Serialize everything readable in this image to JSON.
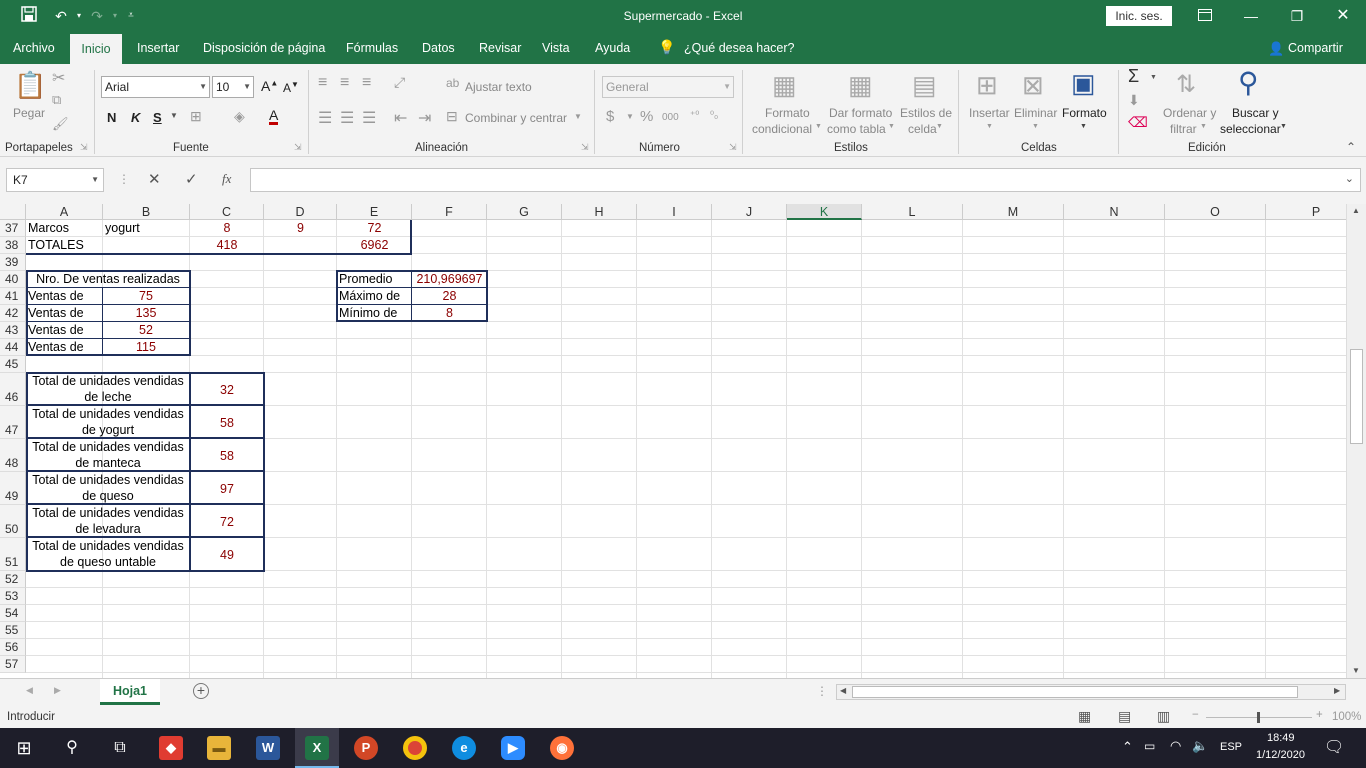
{
  "window": {
    "title": "Supermercado  -  Excel",
    "signin": "Inic. ses."
  },
  "tabs": [
    "Archivo",
    "Inicio",
    "Insertar",
    "Disposición de página",
    "Fórmulas",
    "Datos",
    "Revisar",
    "Vista",
    "Ayuda"
  ],
  "active_tab": "Inicio",
  "search_tell": "¿Qué desea hacer?",
  "share": "Compartir",
  "ribbon": {
    "paste": "Pegar",
    "font_name": "Arial",
    "font_size": "10",
    "bold": "N",
    "italic": "K",
    "underline": "S",
    "wrap_text": "Ajustar texto",
    "merge_center": "Combinar y centrar",
    "number_format": "General",
    "cond_format": [
      "Formato",
      "condicional"
    ],
    "table_format": [
      "Dar formato",
      "como tabla"
    ],
    "cell_styles": [
      "Estilos de",
      "celda"
    ],
    "insert": "Insertar",
    "delete": "Eliminar",
    "format": "Formato",
    "sort_filter": [
      "Ordenar y",
      "filtrar"
    ],
    "find_select": [
      "Buscar y",
      "seleccionar"
    ],
    "groups": [
      "Portapapeles",
      "Fuente",
      "Alineación",
      "Número",
      "Estilos",
      "Celdas",
      "Edición"
    ]
  },
  "namebox": "K7",
  "formula": "",
  "columns": [
    "A",
    "B",
    "C",
    "D",
    "E",
    "F",
    "G",
    "H",
    "I",
    "J",
    "K",
    "L",
    "M",
    "N",
    "O",
    "P"
  ],
  "selected_column": "K",
  "rows": [
    "37",
    "38",
    "39",
    "40",
    "41",
    "42",
    "43",
    "44",
    "45",
    "46",
    "47",
    "48",
    "49",
    "50",
    "51",
    "52",
    "53",
    "54",
    "55",
    "56",
    "57"
  ],
  "cells": {
    "a37": "Marcos",
    "b37": "yogurt",
    "c37": "8",
    "d37": "9",
    "e37": "72",
    "a38": "TOTALES",
    "c38": "418",
    "e38": "6962",
    "a40": "Nro. De ventas realizadas",
    "a41": "Ventas de",
    "b41": "75",
    "a42": "Ventas de",
    "b42": "135",
    "a43": "Ventas de",
    "b43": "52",
    "a44": "Ventas de",
    "b44": "115",
    "e40": "Promedio",
    "f40": "210,969697",
    "e41": "Máximo de",
    "f41": "28",
    "e42": "Mínimo de",
    "f42": "8",
    "a46": [
      "Total de unidades vendidas",
      "de leche"
    ],
    "c46": "32",
    "a47": [
      "Total de unidades vendidas",
      "de yogurt"
    ],
    "c47": "58",
    "a48": [
      "Total de unidades vendidas",
      "de manteca"
    ],
    "c48": "58",
    "a49": [
      "Total de unidades vendidas",
      "de queso"
    ],
    "c49": "97",
    "a50": [
      "Total de unidades vendidas",
      "de levadura"
    ],
    "c50": "72",
    "a51": [
      "Total de unidades vendidas",
      "de queso untable"
    ],
    "c51": "49"
  },
  "sheet_tab": "Hoja1",
  "status": {
    "mode": "Introducir",
    "zoom": "100%"
  },
  "taskbar": {
    "lang": "ESP",
    "time": "18:49",
    "date": "1/12/2020"
  },
  "colors": {
    "excel_green": "#217346",
    "value_red": "#8b0000",
    "border_navy": "#1f2f5a"
  }
}
